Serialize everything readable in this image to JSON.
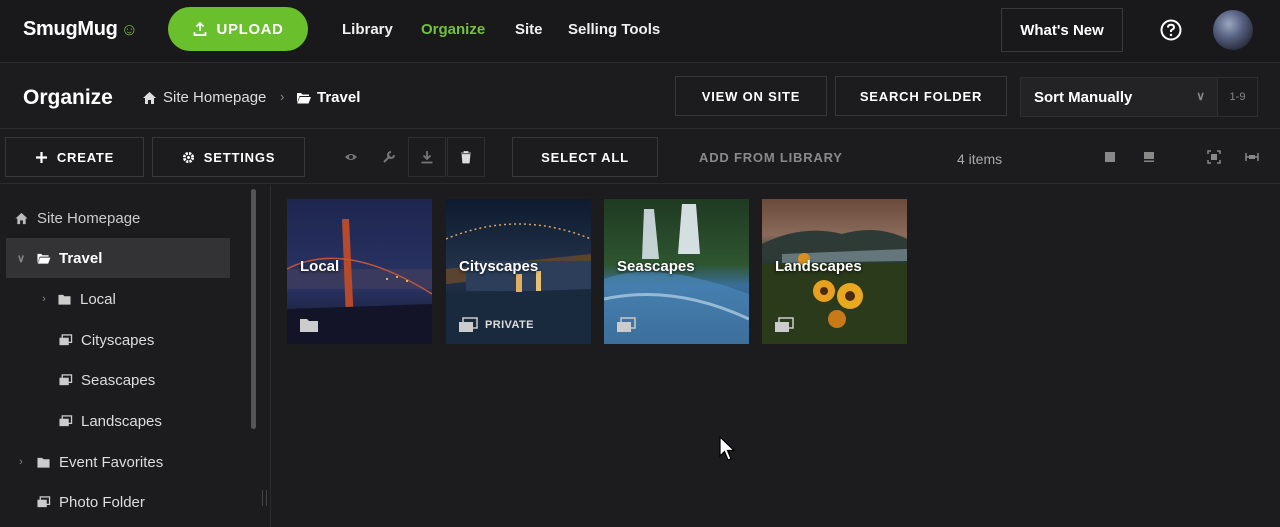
{
  "topbar": {
    "brand": "SmugMug",
    "upload_label": "UPLOAD",
    "nav": [
      "Library",
      "Organize",
      "Site",
      "Selling Tools"
    ],
    "active_nav": "Organize",
    "whats_new": "What's New"
  },
  "header": {
    "title": "Organize",
    "breadcrumb": [
      "Site Homepage",
      "Travel"
    ],
    "view_on_site": "VIEW ON SITE",
    "search_folder": "SEARCH FOLDER",
    "sort_value": "Sort Manually",
    "range": "1-9"
  },
  "toolbar": {
    "create": "CREATE",
    "settings": "SETTINGS",
    "select_all": "SELECT ALL",
    "add_from_library": "ADD FROM LIBRARY",
    "item_count": "4 items"
  },
  "sidebar": {
    "items": [
      {
        "label": "Site Homepage",
        "icon": "home-icon"
      },
      {
        "label": "Travel",
        "icon": "folder-open-icon"
      },
      {
        "label": "Local",
        "icon": "folder-icon"
      },
      {
        "label": "Cityscapes",
        "icon": "gallery-icon"
      },
      {
        "label": "Seascapes",
        "icon": "gallery-icon"
      },
      {
        "label": "Landscapes",
        "icon": "gallery-icon"
      },
      {
        "label": "Event Favorites",
        "icon": "folder-icon"
      },
      {
        "label": "Photo Folder",
        "icon": "gallery-icon"
      }
    ]
  },
  "tiles": [
    {
      "label": "Local",
      "icon": "folder-icon",
      "badge": ""
    },
    {
      "label": "Cityscapes",
      "icon": "gallery-icon",
      "badge": "PRIVATE"
    },
    {
      "label": "Seascapes",
      "icon": "gallery-icon",
      "badge": ""
    },
    {
      "label": "Landscapes",
      "icon": "gallery-icon",
      "badge": ""
    }
  ],
  "colors": {
    "accent": "#6abf2d",
    "active_nav": "#72c23a",
    "background": "#1c1c1e"
  }
}
